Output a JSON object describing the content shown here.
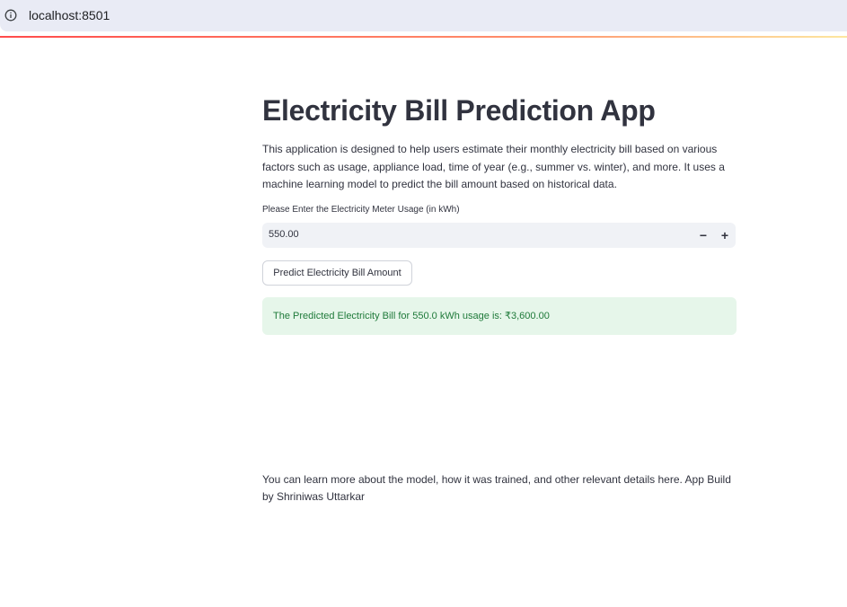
{
  "browser": {
    "url": "localhost:8501",
    "info_icon": "info-circle-icon"
  },
  "theme": {
    "accent_start": "#ff4b4b",
    "accent_end": "#fde7a0",
    "success_bg": "#e6f6ea",
    "success_text": "#1f7a3a",
    "input_bg": "#f0f2f6"
  },
  "app": {
    "title": "Electricity Bill Prediction App",
    "description": "This application is designed to help users estimate their monthly electricity bill based on various factors such as usage, appliance load, time of year (e.g., summer vs. winter), and more. It uses a machine learning model to predict the bill amount based on historical data.",
    "usage_input": {
      "label": "Please Enter the Electricity Meter Usage (in kWh)",
      "value": "550.00",
      "decrement_label": "−",
      "increment_label": "+"
    },
    "predict_button": "Predict Electricity Bill Amount",
    "result": "The Predicted Electricity Bill for 550.0 kWh usage is: ₹3,600.00",
    "footer": "You can learn more about the model, how it was trained, and other relevant details here. App Build by Shriniwas Uttarkar"
  }
}
